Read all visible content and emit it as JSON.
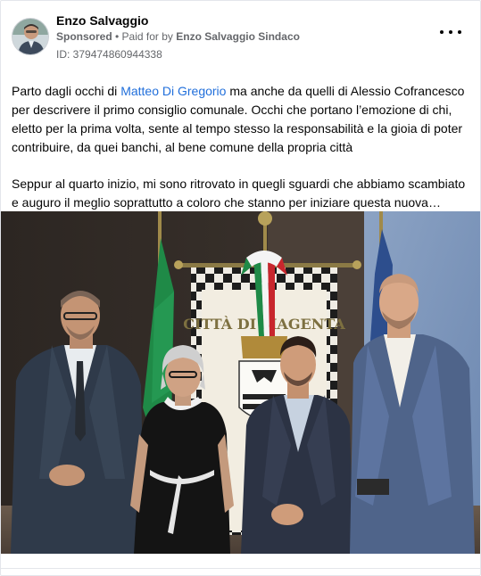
{
  "post": {
    "author_name": "Enzo Salvaggio",
    "sponsored_label": "Sponsored",
    "separator": " • ",
    "paid_for_prefix": "Paid for by ",
    "paid_for_by": "Enzo Salvaggio Sindaco",
    "ad_id": "ID: 379474860944338",
    "more_icon": "more-horizontal-icon",
    "paragraph1": {
      "before_mention": "Parto dagli occhi di ",
      "mention": "Matteo Di Gregorio",
      "after_mention": " ma anche da quelli di Alessio Cofrancesco per descrivere il primo consiglio comunale. Occhi che portano l’emozione di chi, eletto per la prima volta, sente al tempo stesso la responsabilità e la gioia di poter contribuire, da quei banchi, al bene comune della propria città"
    },
    "paragraph2": "Seppur al quarto inizio, mi sono ritrovato in quegli sguardi che abbiamo scambiato e auguro il meglio soprattutto a coloro che stanno per iniziare questa nuova…",
    "photo": {
      "banner_text": "CITTÀ DI MAGENTA"
    }
  },
  "colors": {
    "link": "#216fdb",
    "secondary_text": "#65676b"
  }
}
